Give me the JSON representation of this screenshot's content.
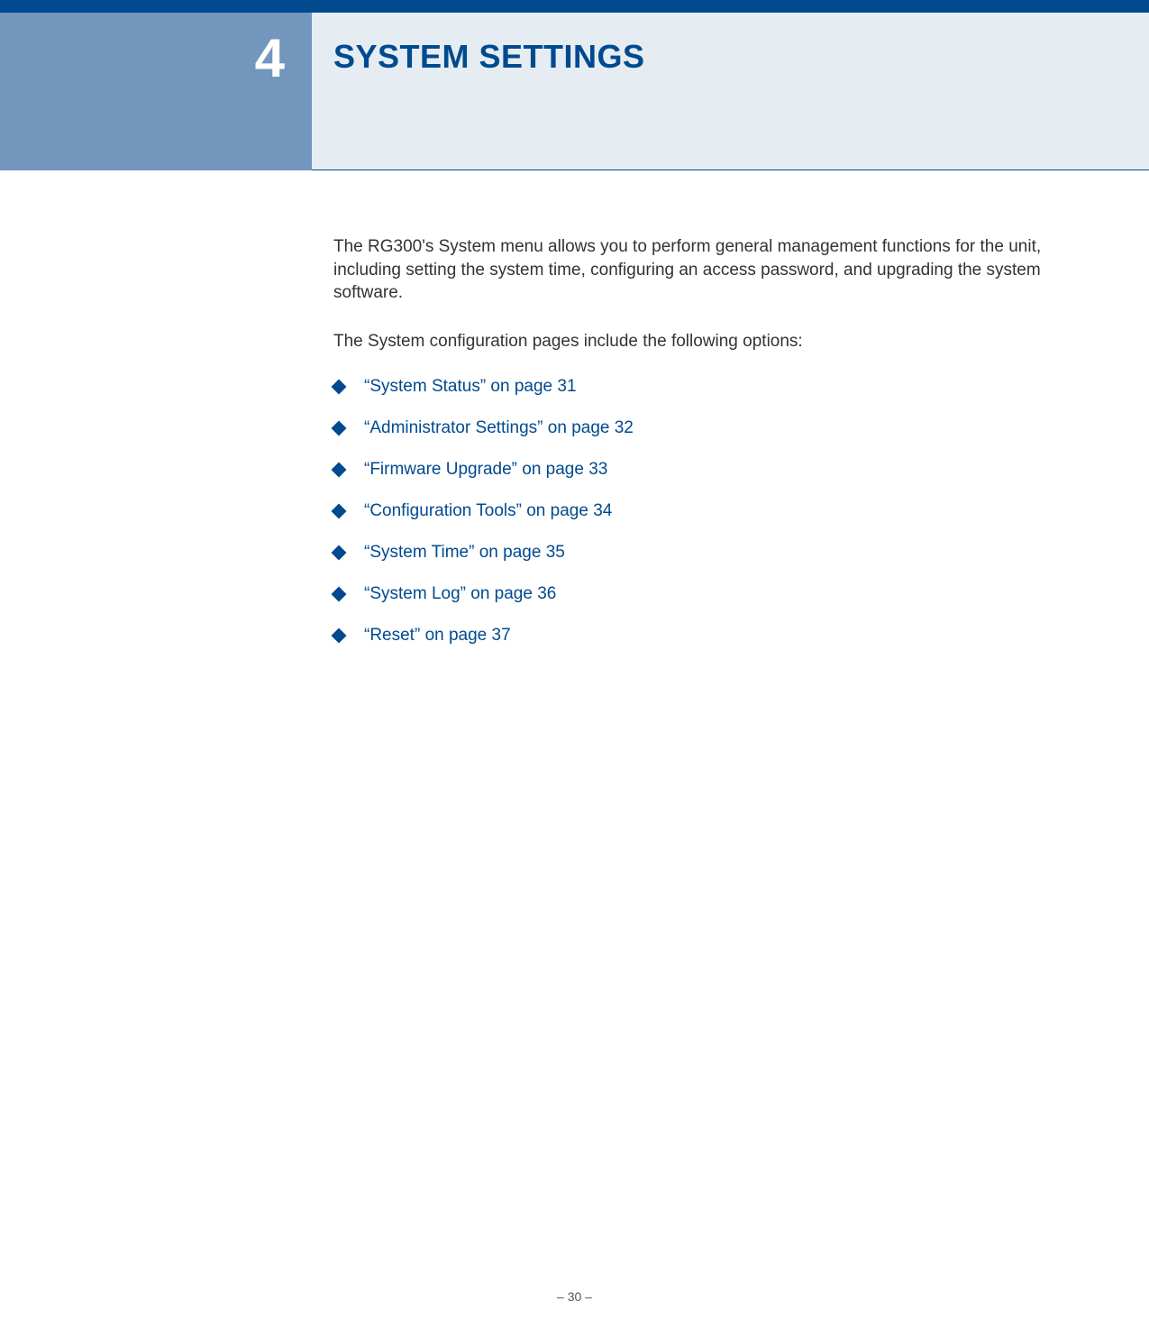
{
  "chapter": {
    "number": "4",
    "title": "SYSTEM SETTINGS"
  },
  "content": {
    "intro": "The RG300's System menu allows you to perform general management functions for the unit, including setting the system time, configuring an access password, and upgrading the system software.",
    "options_intro": "The System configuration pages include the following options:",
    "links": [
      "“System Status” on page 31",
      "“Administrator Settings” on page 32",
      "“Firmware Upgrade” on page 33",
      "“Configuration Tools” on page 34",
      "“System Time” on page 35",
      "“System Log” on page 36",
      "“Reset” on page 37"
    ]
  },
  "footer": {
    "page_number": "–  30  –"
  }
}
